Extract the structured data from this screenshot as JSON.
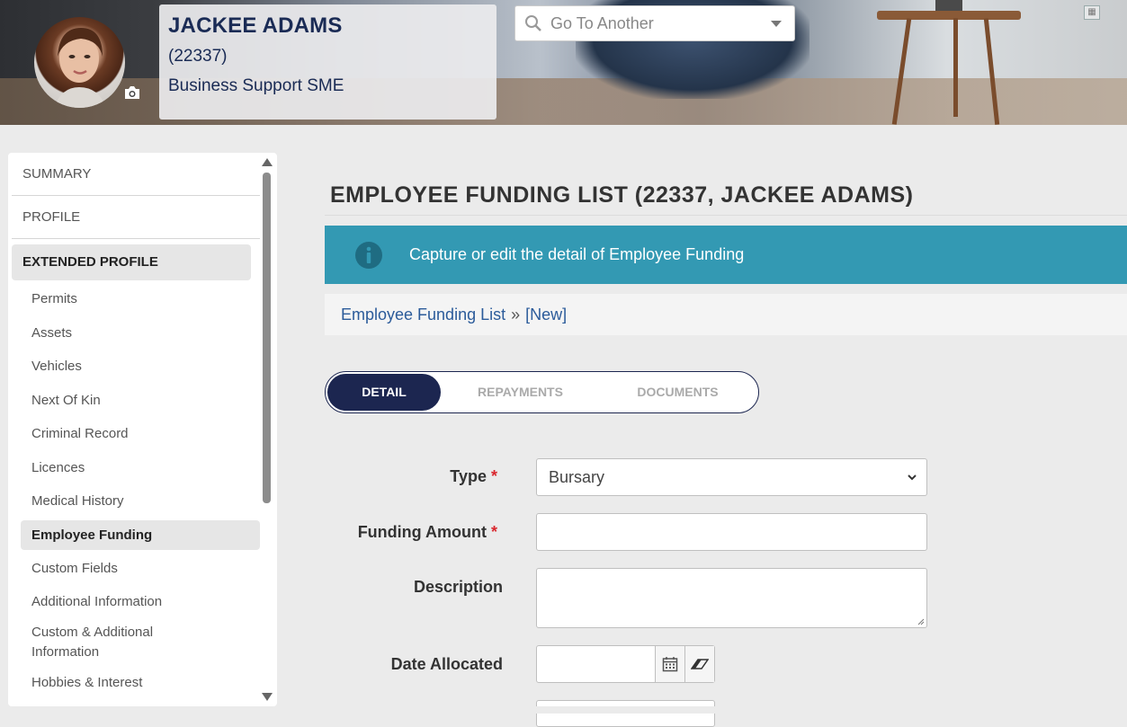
{
  "header": {
    "employee_name": "JACKEE ADAMS",
    "employee_code": "(22337)",
    "employee_role": "Business Support SME",
    "goto_placeholder": "Go To Another"
  },
  "sidebar": {
    "top_items": [
      {
        "label": "SUMMARY"
      },
      {
        "label": "PROFILE"
      },
      {
        "label": "EXTENDED PROFILE",
        "active": true
      }
    ],
    "sub_items": [
      {
        "label": "Permits"
      },
      {
        "label": "Assets"
      },
      {
        "label": "Vehicles"
      },
      {
        "label": "Next Of Kin"
      },
      {
        "label": "Criminal Record"
      },
      {
        "label": "Licences"
      },
      {
        "label": "Medical History"
      },
      {
        "label": "Employee Funding",
        "active": true
      },
      {
        "label": "Custom Fields"
      },
      {
        "label": "Additional Information"
      },
      {
        "label": "Custom & Additional Information"
      },
      {
        "label": "Hobbies & Interest"
      }
    ]
  },
  "main": {
    "title": "EMPLOYEE FUNDING LIST (22337, JACKEE ADAMS)",
    "info_message": "Capture or edit the detail of Employee Funding",
    "breadcrumb": {
      "parent": "Employee Funding List",
      "separator": "»",
      "current": "[New]"
    },
    "tabs": [
      {
        "label": "DETAIL",
        "active": true
      },
      {
        "label": "REPAYMENTS"
      },
      {
        "label": "DOCUMENTS"
      }
    ],
    "form": {
      "type_label": "Type",
      "type_value": "Bursary",
      "amount_label": "Funding Amount",
      "amount_value": "",
      "description_label": "Description",
      "description_value": "",
      "date_allocated_label": "Date Allocated",
      "date_allocated_value": "",
      "required_marker": "*"
    }
  },
  "colors": {
    "navy": "#1c2650",
    "info_bar": "#3399b3",
    "link": "#2b5b9a",
    "required": "#d9272e"
  },
  "icons": [
    "camera-icon",
    "search-icon",
    "chevron-down-icon",
    "info-icon",
    "calendar-icon",
    "eraser-icon",
    "grid-icon"
  ]
}
